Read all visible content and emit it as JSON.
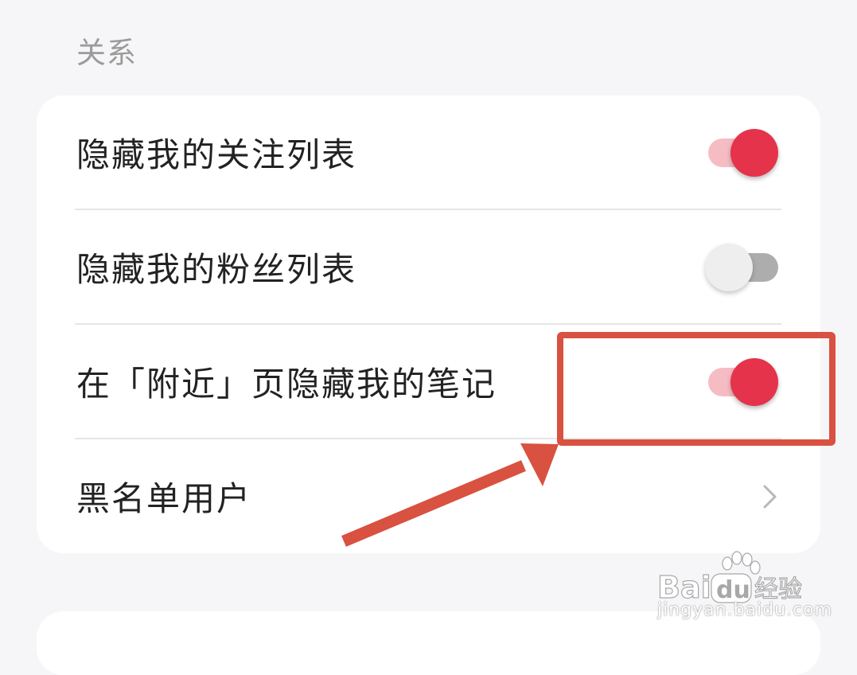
{
  "section": {
    "title": "关系"
  },
  "rows": [
    {
      "label": "隐藏我的关注列表",
      "control": "toggle",
      "state": "on"
    },
    {
      "label": "隐藏我的粉丝列表",
      "control": "toggle",
      "state": "off"
    },
    {
      "label": "在「附近」页隐藏我的笔记",
      "control": "toggle",
      "state": "on"
    },
    {
      "label": "黑名单用户",
      "control": "chevron",
      "icon": "chevron-right-icon"
    }
  ],
  "colors": {
    "toggle_on_knob": "#e4334b",
    "toggle_on_track": "#f6bcc4",
    "toggle_off_knob": "#eeeeee",
    "toggle_off_track": "#adadad",
    "annotation": "#d95140"
  },
  "watermark": {
    "logo": "Baidu经验",
    "url": "jingyan.baidu.com"
  }
}
